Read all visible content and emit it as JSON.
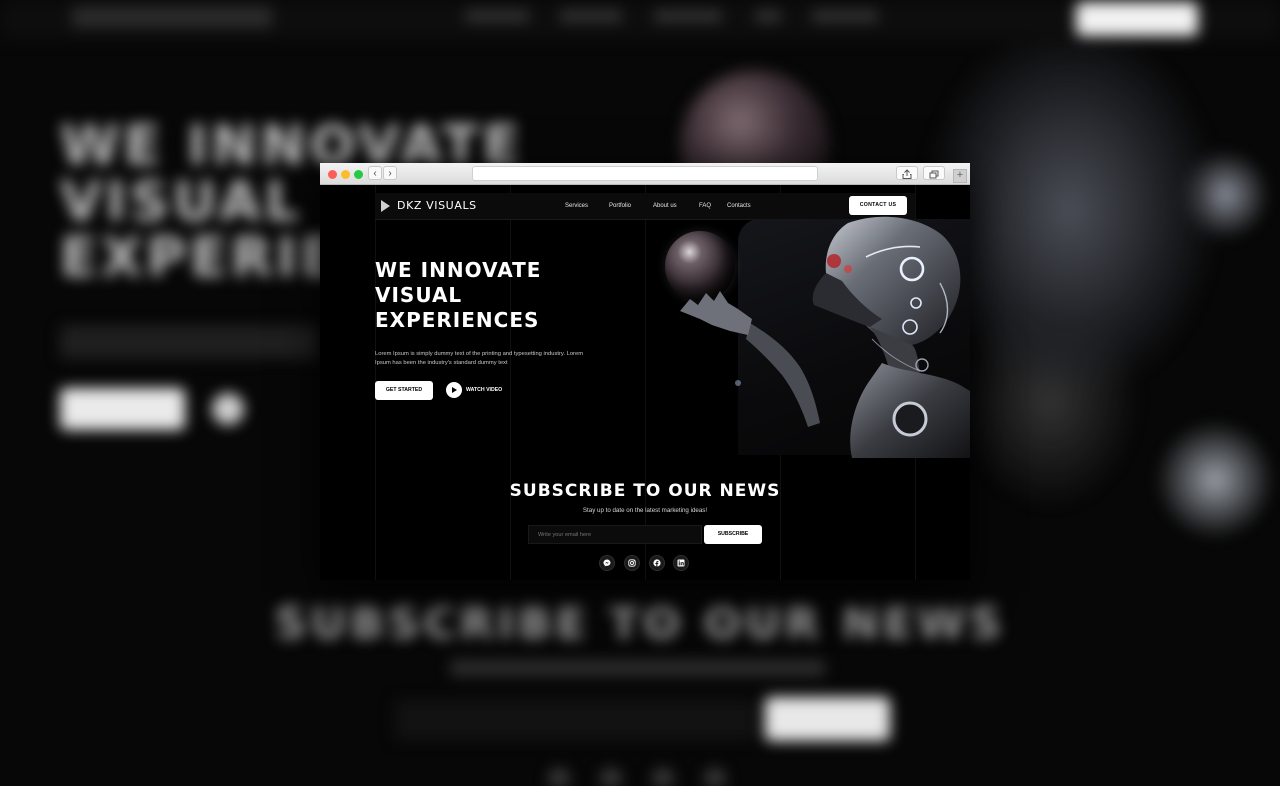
{
  "site": {
    "brand": "DKZ VISUALS",
    "nav": {
      "services": "Services",
      "portfolio": "Portfolio",
      "about": "About us",
      "faq": "FAQ",
      "contacts": "Contacts"
    },
    "contact_button": "CONTACT US"
  },
  "hero": {
    "title_line1": "WE INNOVATE",
    "title_line2": "VISUAL",
    "title_line3": "EXPERIENCES",
    "description": "Lorem Ipsum is simply dummy text of the printing and typesetting industry. Lorem Ipsum has been the industry's standard dummy text",
    "primary_button": "GET STARTED",
    "secondary_button": "WATCH VIDEO"
  },
  "subscribe": {
    "title": "SUBSCRIBE TO OUR NEWS",
    "subtitle": "Stay up to date on the latest marketing ideas!",
    "email_placeholder": "Write your email here",
    "button": "SUBSCRIBE"
  },
  "social_icons": [
    "messenger-icon",
    "instagram-icon",
    "facebook-icon",
    "linkedin-icon"
  ],
  "backdrop": {
    "hero_line1": "WE INNOVATE",
    "hero_line2": "VISUAL",
    "hero_line3": "EXPERIENCES",
    "subscribe_title": "SUBSCRIBE TO OUR NEWS"
  },
  "colors": {
    "background": "#000000",
    "accent": "#ffffff",
    "robot_highlight": "#c0392b"
  }
}
